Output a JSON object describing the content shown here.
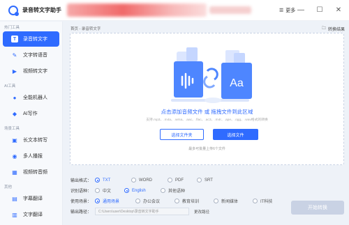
{
  "app": {
    "title": "录音转文字助手",
    "more_label": "更多"
  },
  "sidebar": {
    "groups": [
      {
        "title": "热门工具",
        "items": [
          {
            "label": "录音转文字",
            "icon": "T",
            "active": true
          },
          {
            "label": "文字转语音",
            "icon": "✎",
            "active": false
          },
          {
            "label": "视频转文字",
            "icon": "▶",
            "active": false
          }
        ]
      },
      {
        "title": "AI工具",
        "items": [
          {
            "label": "全能机器人",
            "icon": "●",
            "active": false
          },
          {
            "label": "AI写作",
            "icon": "◆",
            "active": false
          }
        ]
      },
      {
        "title": "场景工具",
        "items": [
          {
            "label": "长文本转写",
            "icon": "▣",
            "active": false
          },
          {
            "label": "多人播报",
            "icon": "◉",
            "active": false
          },
          {
            "label": "视频转音频",
            "icon": "▦",
            "active": false
          }
        ]
      },
      {
        "title": "其他",
        "items": [
          {
            "label": "字幕翻译",
            "icon": "▤",
            "active": false
          },
          {
            "label": "文字翻译",
            "icon": "▥",
            "active": false
          }
        ]
      }
    ]
  },
  "main": {
    "breadcrumb": "首页 - 录音转文字",
    "convert_result_label": "转换结果",
    "drop_hint": "点击添加音频文件 或 拖拽文件到此区域",
    "supported_formats": "支持.mp3、.m4a、.wma、.aac、.flac、.ac3、.m4r、.ape、.ogg、.wav格式的转换",
    "select_folder_label": "选择文件夹",
    "select_file_label": "选择文件",
    "limit_text": "最多可批量上传6个文件",
    "output_format": {
      "label": "输出格式：",
      "options": [
        "TXT",
        "WORD",
        "PDF",
        "SRT"
      ],
      "selected": "TXT"
    },
    "language": {
      "label": "识别语种：",
      "options": [
        "中文",
        "English",
        "其他语种"
      ],
      "selected": "English"
    },
    "scenario": {
      "label": "使用场景：",
      "options": [
        "通用场景",
        "办公会议",
        "教育培训",
        "新闻媒体",
        "IT科技"
      ],
      "selected": "通用场景"
    },
    "output_path": {
      "label": "输出路径：",
      "value": "C:\\Users\\user\\Desktop\\录音转文字助手",
      "change_label": "更改路径"
    },
    "start_label": "开始转换"
  },
  "colors": {
    "accent": "#2f6bff",
    "disabled_button": "#c9d2e4"
  }
}
